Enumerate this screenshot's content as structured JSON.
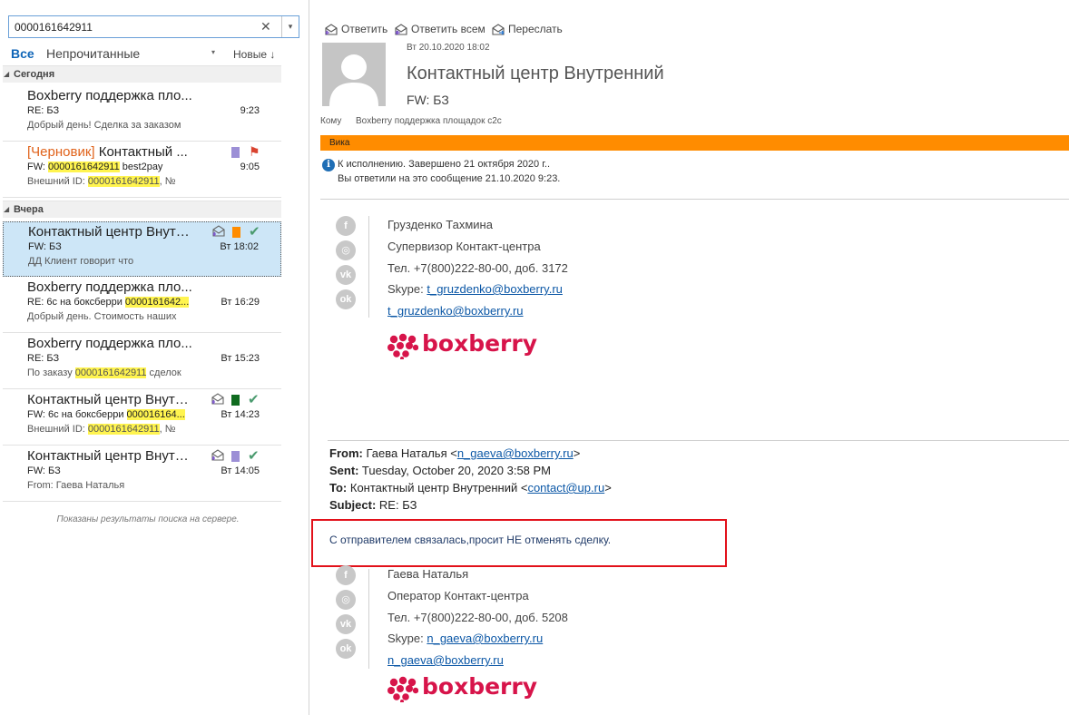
{
  "search": {
    "value": "0000161642911",
    "clear": "✕",
    "dropdown": "▾"
  },
  "filters": {
    "all": "Все",
    "unread": "Непрочитанные",
    "unread_dropdown": "▾",
    "sort": "Новые ↓"
  },
  "groups": [
    {
      "label": "Сегодня"
    },
    {
      "label": "Вчера"
    }
  ],
  "messages": [
    {
      "sender": "Boxberry поддержка пло...",
      "subject": "RE: БЗ",
      "preview": "Добрый день!  Сделка за заказом",
      "time": "9:23"
    },
    {
      "draft_tag": "[Черновик]",
      "sender": " Контактный ...",
      "subject_pre": "FW: ",
      "subject_hl": "0000161642911",
      "subject_post": "   best2pay",
      "preview_pre": "Внешний ID: ",
      "preview_hl": "0000161642911",
      "preview_post": ", №",
      "time": "9:05",
      "category_color": "#9c8fd6"
    },
    {
      "sender": "Контактный центр Внутр...",
      "subject": "FW: БЗ",
      "preview": "ДД  Клиент  говорит что",
      "time": "Вт 18:02",
      "category_color": "#ff8c00"
    },
    {
      "sender": "Boxberry поддержка пло...",
      "subject_pre": "RE: 6с на боксберри ",
      "subject_hl": "0000161642...",
      "preview": "Добрый день.  Стоимость наших",
      "time": "Вт 16:29"
    },
    {
      "sender": "Boxberry поддержка пло...",
      "subject": "RE: БЗ",
      "preview_pre": "По заказу ",
      "preview_hl": "0000161642911",
      "preview_post": " сделок",
      "time": "Вт 15:23"
    },
    {
      "sender": "Контактный центр Внутр...",
      "subject_pre": "FW: 6с на боксберри ",
      "subject_hl": "000016164...",
      "preview_pre": "Внешний ID: ",
      "preview_hl": "0000161642911",
      "preview_post": ", №",
      "time": "Вт 14:23",
      "category_color": "#0f6b1f"
    },
    {
      "sender": "Контактный центр Внутр...",
      "subject": "FW: БЗ",
      "preview": "From: Гаева Наталья",
      "time": "Вт 14:05",
      "category_color": "#9c8fd6"
    }
  ],
  "server_note": "Показаны результаты поиска на сервере.",
  "toolbar": {
    "reply": "Ответить",
    "reply_all": "Ответить всем",
    "forward": "Переслать"
  },
  "reading": {
    "date": "Вт 20.10.2020 18:02",
    "from": "Контактный центр Внутренний",
    "subject": "FW: БЗ",
    "to_label": "Кому",
    "to_value": "Boxberry поддержка площадок c2c",
    "category": "Вика",
    "info_line1": "К исполнению.  Завершено 21 октября 2020 г..",
    "info_line2": "Вы ответили на это сообщение 21.10.2020 9:23."
  },
  "signature1": {
    "name": "Грузденко Тахмина",
    "role": "Супервизор Контакт-центра",
    "phone": "Тел. +7(800)222-80-00, доб. 3172",
    "skype_label": "Skype: ",
    "skype": "t_gruzdenko@boxberry.ru",
    "email": "t_gruzdenko@boxberry.ru",
    "logo": "boxberry"
  },
  "forwarded": {
    "from_label": "From:",
    "from_value": "Гаева Наталья <",
    "from_email": "n_gaeva@boxberry.ru",
    "from_close": ">",
    "sent_label": "Sent:",
    "sent_value": "Tuesday, October 20, 2020 3:58 PM",
    "to_label": "To:",
    "to_value": "Контактный центр Внутренний <",
    "to_email": "contact@up.ru",
    "to_close": ">",
    "subject_label": "Subject:",
    "subject_value": "RE: БЗ",
    "body": "С отправителем связалась,просит НЕ отменять сделку."
  },
  "signature2": {
    "name": "Гаева Наталья",
    "role": "Оператор Контакт-центра",
    "phone": "Тел. +7(800)222-80-00, доб. 5208",
    "skype_label": "Skype: ",
    "skype": "n_gaeva@boxberry.ru",
    "email": "n_gaeva@boxberry.ru",
    "logo": "boxberry"
  },
  "social_icons": [
    "facebook-icon",
    "instagram-icon",
    "vk-icon",
    "odnoklassniki-icon"
  ],
  "colors": {
    "accent": "#1066b8",
    "category_bar": "#ff8c00",
    "brand": "#d7144a",
    "highlight_box": "#e2111a",
    "search_highlight": "#fff44f"
  }
}
